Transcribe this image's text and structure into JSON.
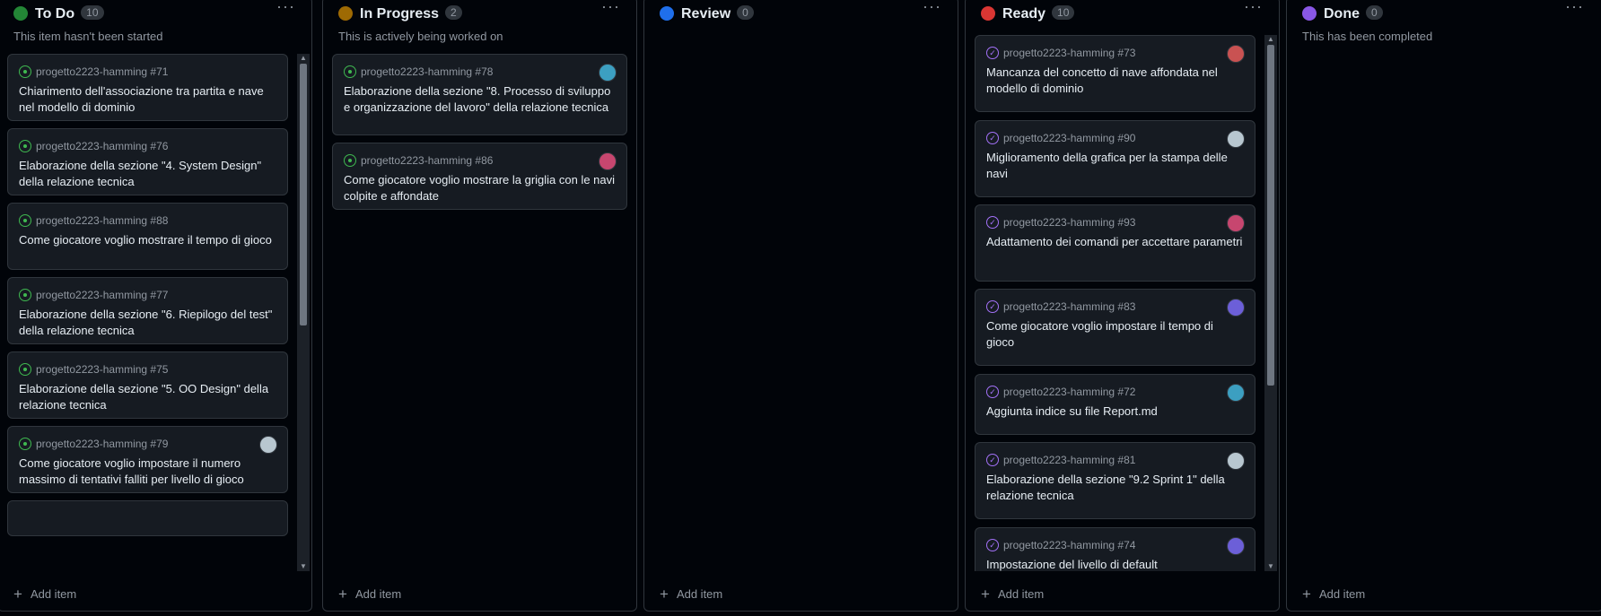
{
  "add_label": "Add item",
  "menu_glyph": "···",
  "plus_glyph": "+",
  "columns": [
    {
      "title": "To Do",
      "count": "10",
      "color": "#238636",
      "description": "This item hasn't been started",
      "cards": [
        {
          "ref": "progetto2223-hamming #71",
          "title": "Chiarimento dell'associazione tra partita e nave nel modello di dominio"
        },
        {
          "ref": "progetto2223-hamming #76",
          "title": "Elaborazione della sezione \"4. System Design\" della relazione tecnica"
        },
        {
          "ref": "progetto2223-hamming #88",
          "title": "Come giocatore voglio mostrare il tempo di gioco"
        },
        {
          "ref": "progetto2223-hamming #77",
          "title": "Elaborazione della sezione \"6. Riepilogo del test\" della relazione tecnica"
        },
        {
          "ref": "progetto2223-hamming #75",
          "title": "Elaborazione della sezione \"5. OO Design\" della relazione tecnica"
        },
        {
          "ref": "progetto2223-hamming #79",
          "title": "Come giocatore voglio impostare il numero massimo di tentativi falliti per livello di gioco"
        },
        {
          "ref": "",
          "title": ""
        }
      ]
    },
    {
      "title": "In Progress",
      "count": "2",
      "color": "#9e6a03",
      "description": "This is actively being worked on",
      "cards": [
        {
          "ref": "progetto2223-hamming #78",
          "title": "Elaborazione della sezione \"8. Processo di sviluppo e organizzazione del lavoro\" della relazione tecnica"
        },
        {
          "ref": "progetto2223-hamming #86",
          "title": "Come giocatore voglio mostrare la griglia con le navi colpite e affondate"
        }
      ]
    },
    {
      "title": "Review",
      "count": "0",
      "color": "#1f6feb",
      "description": "",
      "cards": []
    },
    {
      "title": "Ready",
      "count": "10",
      "color": "#da3633",
      "description": "",
      "cards": [
        {
          "ref": "progetto2223-hamming #73",
          "title": "Mancanza del concetto di nave affondata nel modello di dominio"
        },
        {
          "ref": "progetto2223-hamming #90",
          "title": "Miglioramento della grafica per la stampa delle navi"
        },
        {
          "ref": "progetto2223-hamming #93",
          "title": "Adattamento dei comandi per accettare parametri"
        },
        {
          "ref": "progetto2223-hamming #83",
          "title": "Come giocatore voglio impostare il tempo di gioco"
        },
        {
          "ref": "progetto2223-hamming #72",
          "title": "Aggiunta indice su file Report.md"
        },
        {
          "ref": "progetto2223-hamming #81",
          "title": "Elaborazione della sezione \"9.2 Sprint 1\" della relazione tecnica"
        },
        {
          "ref": "progetto2223-hamming #74",
          "title": "Impostazione del livello di default"
        }
      ]
    },
    {
      "title": "Done",
      "count": "0",
      "color": "#8957e5",
      "description": "This has been completed",
      "cards": []
    }
  ],
  "avatar_colors": {
    "teal": "#3c9fc1",
    "red": "#c95252",
    "light": "#b8c7d0",
    "pink": "#c7466f",
    "purple": "#6c5fd8"
  }
}
